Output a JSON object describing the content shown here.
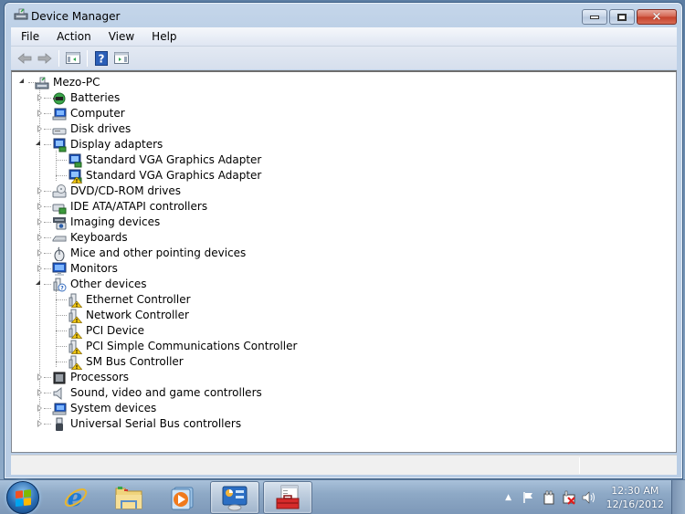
{
  "window": {
    "title": "Device Manager"
  },
  "menu": {
    "items": [
      "File",
      "Action",
      "View",
      "Help"
    ]
  },
  "toolbar": {
    "buttons": [
      "back-icon",
      "forward-icon",
      "show-hide-console-tree-icon",
      "help-icon",
      "show-hide-action-pane-icon"
    ]
  },
  "tree": {
    "root": {
      "label": "Mezo-PC",
      "icon": "computer-tower-icon",
      "expanded": true
    },
    "nodes": [
      {
        "label": "Batteries",
        "icon": "battery-icon",
        "level": 1,
        "expander": "collapsed"
      },
      {
        "label": "Computer",
        "icon": "computer-icon",
        "level": 1,
        "expander": "collapsed"
      },
      {
        "label": "Disk drives",
        "icon": "disk-drive-icon",
        "level": 1,
        "expander": "collapsed"
      },
      {
        "label": "Display adapters",
        "icon": "display-adapter-icon",
        "level": 1,
        "expander": "expanded"
      },
      {
        "label": "Standard VGA Graphics Adapter",
        "icon": "display-adapter-icon",
        "level": 2,
        "warning": false
      },
      {
        "label": "Standard VGA Graphics Adapter",
        "icon": "display-adapter-icon",
        "level": 2,
        "warning": true
      },
      {
        "label": "DVD/CD-ROM drives",
        "icon": "dvd-drive-icon",
        "level": 1,
        "expander": "collapsed"
      },
      {
        "label": "IDE ATA/ATAPI controllers",
        "icon": "ide-controller-icon",
        "level": 1,
        "expander": "collapsed"
      },
      {
        "label": "Imaging devices",
        "icon": "camera-icon",
        "level": 1,
        "expander": "collapsed"
      },
      {
        "label": "Keyboards",
        "icon": "keyboard-icon",
        "level": 1,
        "expander": "collapsed"
      },
      {
        "label": "Mice and other pointing devices",
        "icon": "mouse-icon",
        "level": 1,
        "expander": "collapsed"
      },
      {
        "label": "Monitors",
        "icon": "monitor-icon",
        "level": 1,
        "expander": "collapsed"
      },
      {
        "label": "Other devices",
        "icon": "unknown-device-icon",
        "level": 1,
        "expander": "expanded"
      },
      {
        "label": "Ethernet Controller",
        "icon": "unknown-device-icon",
        "level": 2,
        "warning": true
      },
      {
        "label": "Network Controller",
        "icon": "unknown-device-icon",
        "level": 2,
        "warning": true
      },
      {
        "label": "PCI Device",
        "icon": "unknown-device-icon",
        "level": 2,
        "warning": true
      },
      {
        "label": "PCI Simple Communications Controller",
        "icon": "unknown-device-icon",
        "level": 2,
        "warning": true
      },
      {
        "label": "SM Bus Controller",
        "icon": "unknown-device-icon",
        "level": 2,
        "warning": true
      },
      {
        "label": "Processors",
        "icon": "processor-icon",
        "level": 1,
        "expander": "collapsed"
      },
      {
        "label": "Sound, video and game controllers",
        "icon": "speaker-icon",
        "level": 1,
        "expander": "collapsed"
      },
      {
        "label": "System devices",
        "icon": "system-devices-icon",
        "level": 1,
        "expander": "collapsed"
      },
      {
        "label": "Universal Serial Bus controllers",
        "icon": "usb-icon",
        "level": 1,
        "expander": "collapsed"
      }
    ]
  },
  "taskbar": {
    "start": "start-button",
    "apps": [
      {
        "name": "internet-explorer",
        "active": false
      },
      {
        "name": "windows-explorer",
        "active": false
      },
      {
        "name": "windows-media-player",
        "active": false
      },
      {
        "name": "control-panel",
        "active": true
      },
      {
        "name": "device-manager",
        "active": true
      }
    ],
    "tray": {
      "icons": [
        "show-hidden-icons-icon",
        "action-center-flag-icon",
        "power-icon",
        "network-disconnected-icon",
        "volume-icon"
      ],
      "time": "12:30 AM",
      "date": "12/16/2012"
    }
  },
  "colors": {
    "close_button": "#c4412a",
    "warning": "#f2c811",
    "selection_accent": "#3399ff"
  }
}
